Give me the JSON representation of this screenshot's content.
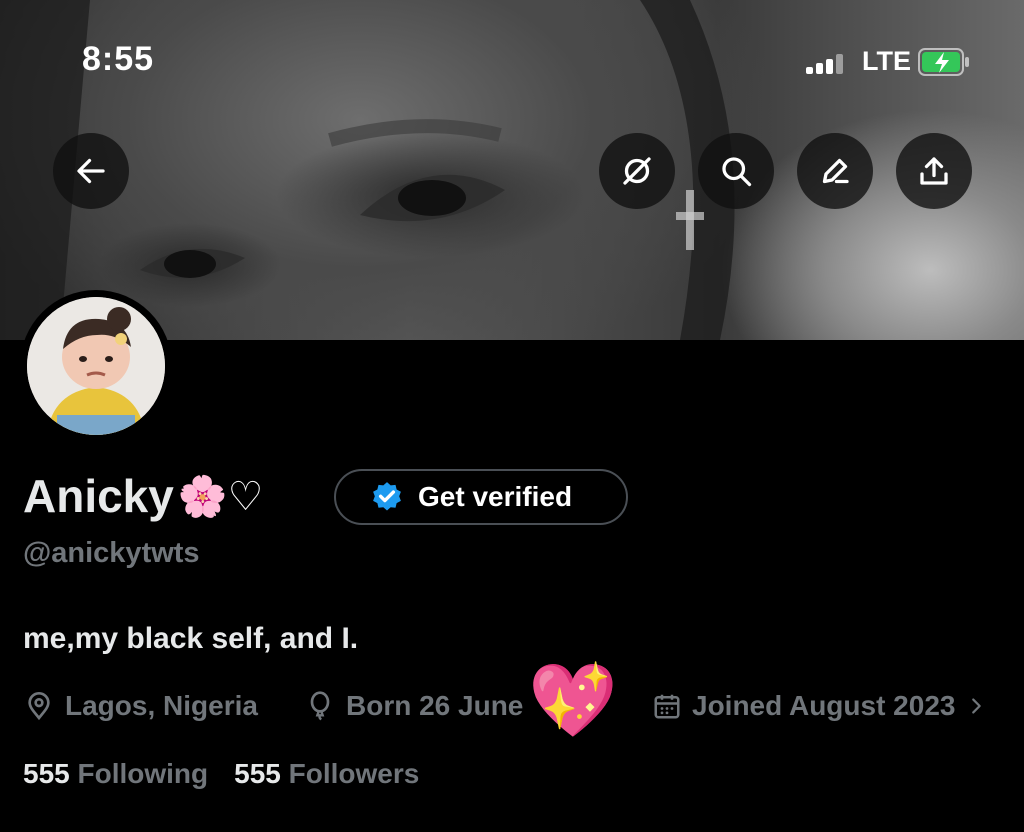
{
  "status_bar": {
    "time": "8:55",
    "network": "LTE",
    "signal_icon": "cellular-signal-icon",
    "battery_icon": "battery-charging-icon"
  },
  "header_actions": {
    "back_icon": "arrow-left-icon",
    "grok_icon": "grok-icon",
    "search_icon": "search-icon",
    "edit_icon": "edit-pencil-icon",
    "share_icon": "share-upload-icon"
  },
  "profile": {
    "display_name": "Anicky",
    "name_emojis": "🌸♡",
    "verify_button": "Get verified",
    "handle": "@anickytwts",
    "bio": "me,my black self, and I.",
    "location": "Lagos, Nigeria",
    "birthday": "Born 26 June",
    "joined": "Joined August 2023",
    "sparkle_heart": "💖",
    "following_count": "555",
    "following_label": "Following",
    "followers_count": "555",
    "followers_label": "Followers"
  },
  "colors": {
    "background": "#000000",
    "text": "#e7e9ea",
    "muted": "#71767b",
    "verified_blue": "#1d9bf0",
    "battery_green": "#34c759"
  }
}
